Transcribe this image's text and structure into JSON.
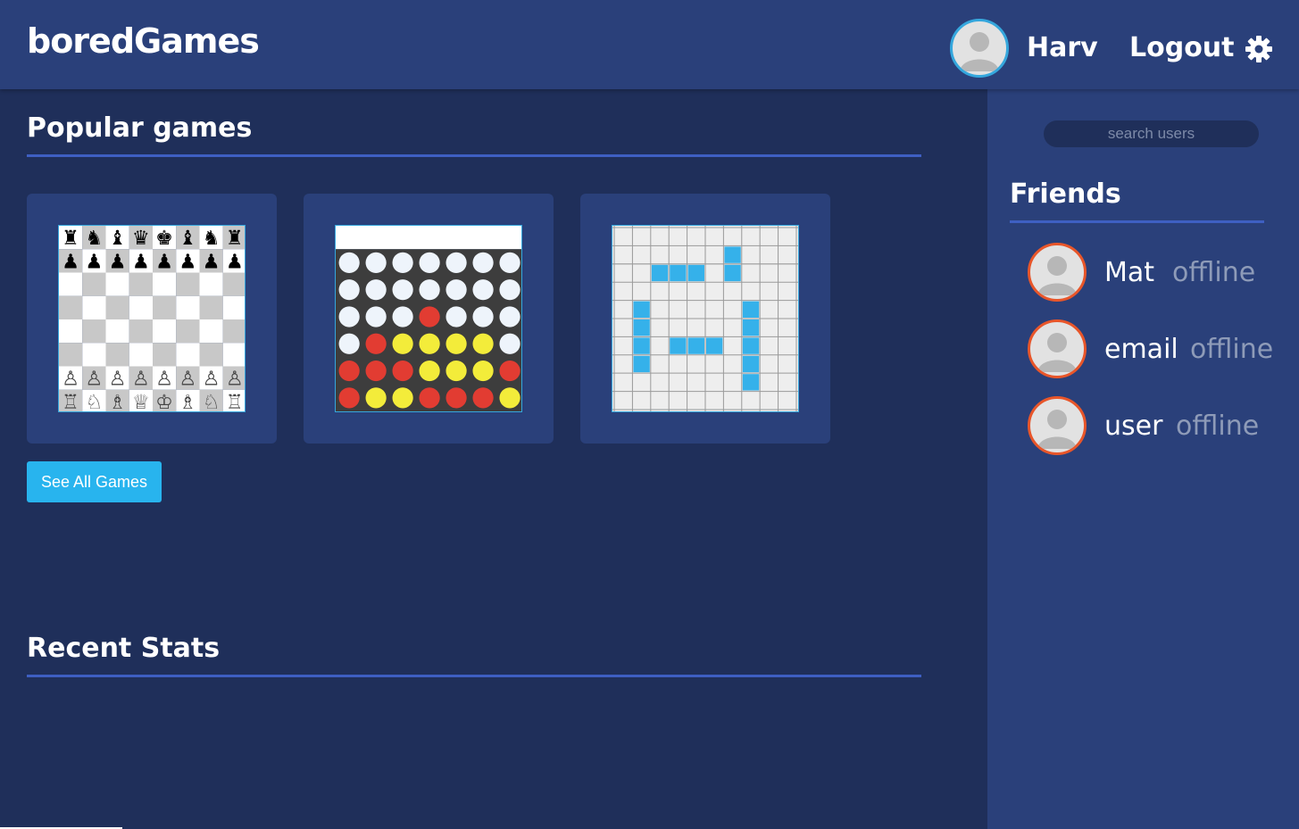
{
  "app": {
    "logo": "boredGames"
  },
  "header": {
    "username": "Harv",
    "logout_label": "Logout",
    "settings_icon": "gear-icon",
    "avatar_icon": "user-avatar-icon"
  },
  "main": {
    "popular_title": "Popular games",
    "games": [
      {
        "id": "chess",
        "thumbnail": "chess-board"
      },
      {
        "id": "connect-four",
        "thumbnail": "connect-four-board"
      },
      {
        "id": "battleship",
        "thumbnail": "battleship-grid"
      }
    ],
    "see_all_label": "See All Games",
    "stats_title": "Recent Stats"
  },
  "sidebar": {
    "search_placeholder": "search users",
    "friends_title": "Friends",
    "friends": [
      {
        "name": "Mat",
        "status": "offline"
      },
      {
        "name": "email",
        "status": "offline"
      },
      {
        "name": "user",
        "status": "offline"
      }
    ]
  },
  "colors": {
    "page_bg": "#1f2f5a",
    "panel_bg": "#2a407a",
    "accent_rule": "#3e5fc2",
    "button": "#28b4ee",
    "header_avatar_ring": "#35a7dd",
    "friend_avatar_ring": "#e8562a",
    "status_text": "#8e9bb8"
  }
}
